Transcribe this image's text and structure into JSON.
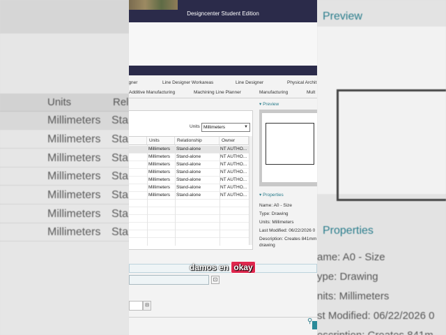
{
  "window": {
    "title": "Designcenter Student Edition"
  },
  "tabs": {
    "row1": [
      "igner",
      "Line Designer Workareas",
      "Line Designer",
      "Physical Archit"
    ],
    "row2": [
      "Additive Manufacturing",
      "Machining Line Planner",
      "Manufacturing",
      "Mult"
    ]
  },
  "units": {
    "label": "Units",
    "selected": "Millimeters"
  },
  "table": {
    "columns": [
      "Units",
      "Relationship",
      "Owner"
    ],
    "rows": [
      [
        "Millimeters",
        "Stand-alone",
        "NT AUTHO..."
      ],
      [
        "Millimeters",
        "Stand-alone",
        "NT AUTHO..."
      ],
      [
        "Millimeters",
        "Stand-alone",
        "NT AUTHO..."
      ],
      [
        "Millimeters",
        "Stand-alone",
        "NT AUTHO..."
      ],
      [
        "Millimeters",
        "Stand-alone",
        "NT AUTHO..."
      ],
      [
        "Millimeters",
        "Stand-alone",
        "NT AUTHO..."
      ],
      [
        "Millimeters",
        "Stand-alone",
        "NT AUTHO..."
      ]
    ]
  },
  "preview": {
    "header": "Preview"
  },
  "properties": {
    "header": "Properties",
    "name": "Name: A0 - Size",
    "type": "Type: Drawing",
    "units": "Units: Millimeters",
    "modified": "Last Modified: 06/22/2026 0",
    "description_1": "Description: Creates 841mm",
    "description_2": "drawing"
  },
  "caption": {
    "before": "damos en",
    "highlight": "okay"
  },
  "background": {
    "left_header": [
      "Units",
      "Relatio"
    ],
    "left_rows": [
      [
        "Millimeters",
        "Stan"
      ],
      [
        "Millimeters",
        "Sta"
      ],
      [
        "Millimeters",
        "Sta"
      ],
      [
        "Millimeters",
        "Sta"
      ],
      [
        "Millimeters",
        "Sta"
      ],
      [
        "Millimeters",
        "Sta"
      ],
      [
        "Millimeters",
        "Sta"
      ]
    ],
    "right_preview": "Preview",
    "right_properties": "Properties",
    "right_lines": [
      "ame: A0 - Size",
      "ype: Drawing",
      "nits: Millimeters",
      "st Modified: 06/22/2026 0",
      "escription: Creates 841m"
    ]
  },
  "colors": {
    "accent": "#2a7d8c",
    "titlebar": "#2b2b4a",
    "caption_highlight": "#e0274e"
  }
}
